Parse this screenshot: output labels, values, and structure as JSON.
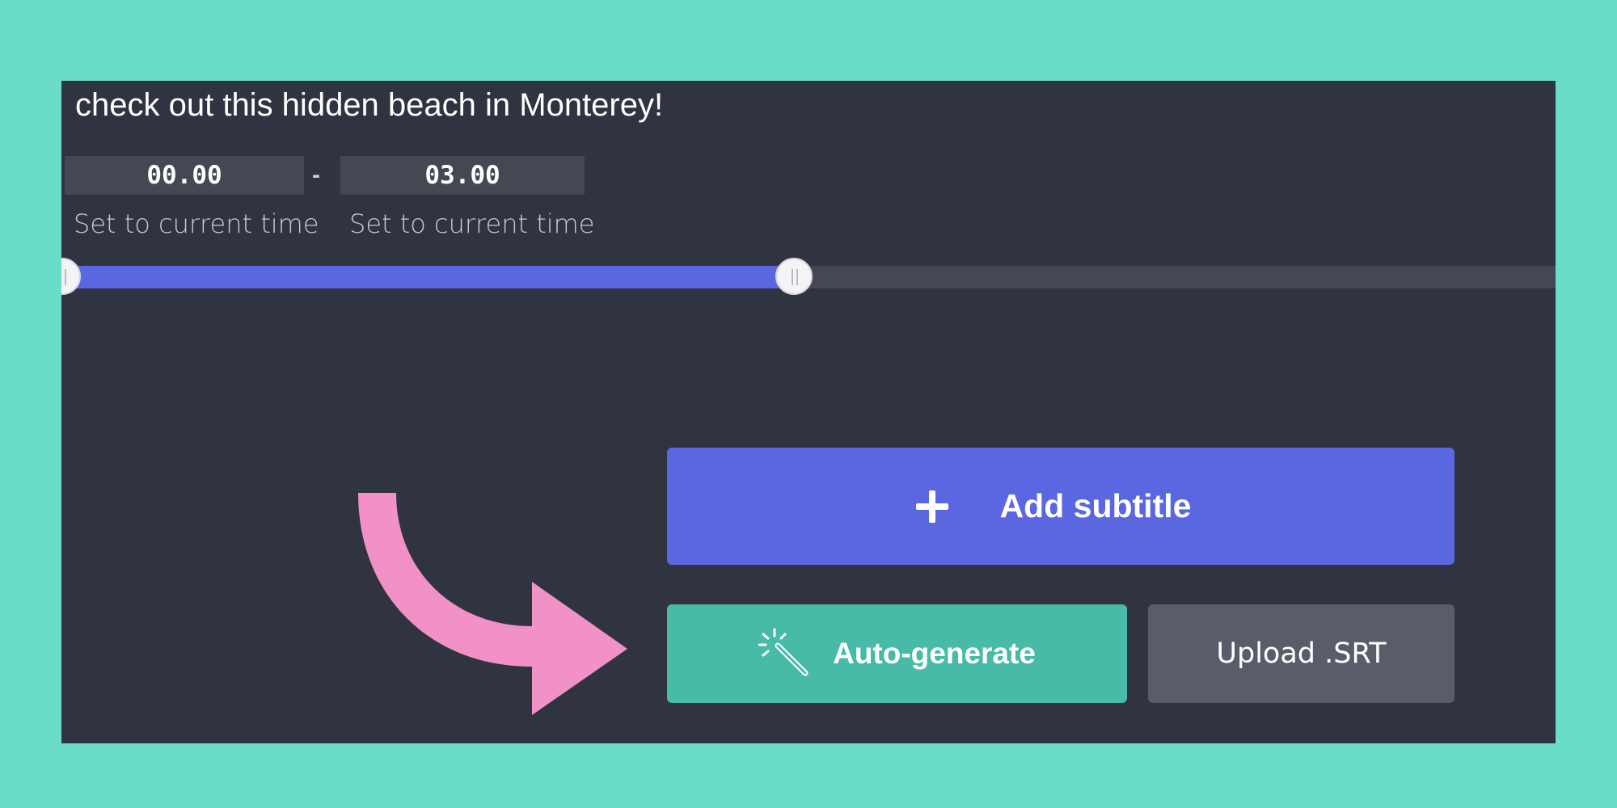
{
  "subtitle": {
    "text": "check out this hidden beach in Monterey!"
  },
  "timing": {
    "start_value": "00.00",
    "end_value": "03.00",
    "separator": "-",
    "set_start_label": "Set to current time",
    "set_end_label": "Set to current time"
  },
  "range": {
    "start_fraction": 0.0,
    "end_fraction": 0.49
  },
  "buttons": {
    "add_subtitle": "Add subtitle",
    "auto_generate": "Auto-generate",
    "upload_srt": "Upload .SRT"
  },
  "icons": {
    "add": "plus-icon",
    "auto": "magic-wand-icon",
    "annotation": "curved-arrow-annotation"
  },
  "colors": {
    "background": "#69ddc8",
    "panel": "#303340",
    "accent_blue": "#5b67e1",
    "accent_green": "#47bba7",
    "upload_gray": "#5a5c6a",
    "annotation_pink": "#f290c8"
  }
}
